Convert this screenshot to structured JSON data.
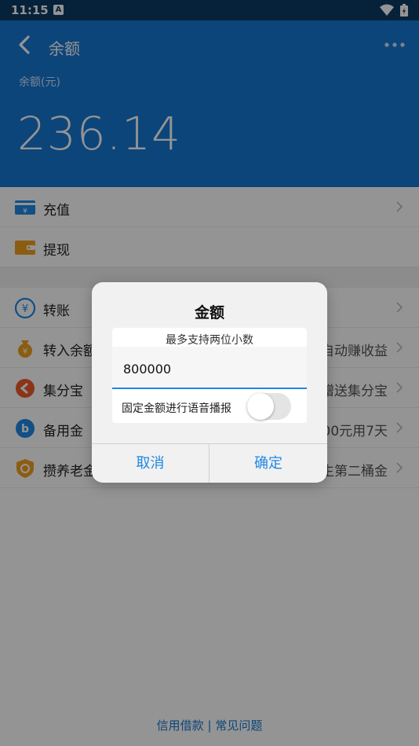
{
  "status_bar": {
    "time": "11:15",
    "notif_letter": "A"
  },
  "header": {
    "title": "余额",
    "balance_label": "余额(元)",
    "balance": "236.14"
  },
  "list": {
    "recharge": {
      "label": "充值"
    },
    "withdraw": {
      "label": "提现"
    },
    "transfer": {
      "label": "转账"
    },
    "to_balance": {
      "label": "转入余额",
      "right": "自动赚收益"
    },
    "jifenbao": {
      "label": "集分宝",
      "right": "赠送集分宝"
    },
    "beiyongjin": {
      "label": "备用金",
      "right": "500元用7天"
    },
    "pension": {
      "label": "攒养老金",
      "right": "人生第二桶金"
    }
  },
  "footer": {
    "credit": "信用借款",
    "sep": "|",
    "faq": "常见问题"
  },
  "dialog": {
    "title": "金额",
    "hint": "最多支持两位小数",
    "amount_value": "800000",
    "toggle_label": "固定金额进行语音播报",
    "toggle_on": false,
    "cancel": "取消",
    "confirm": "确定"
  },
  "colors": {
    "header_blue": "#1677d2",
    "status_bar": "#0b3b67",
    "accent": "#1e88e5"
  }
}
